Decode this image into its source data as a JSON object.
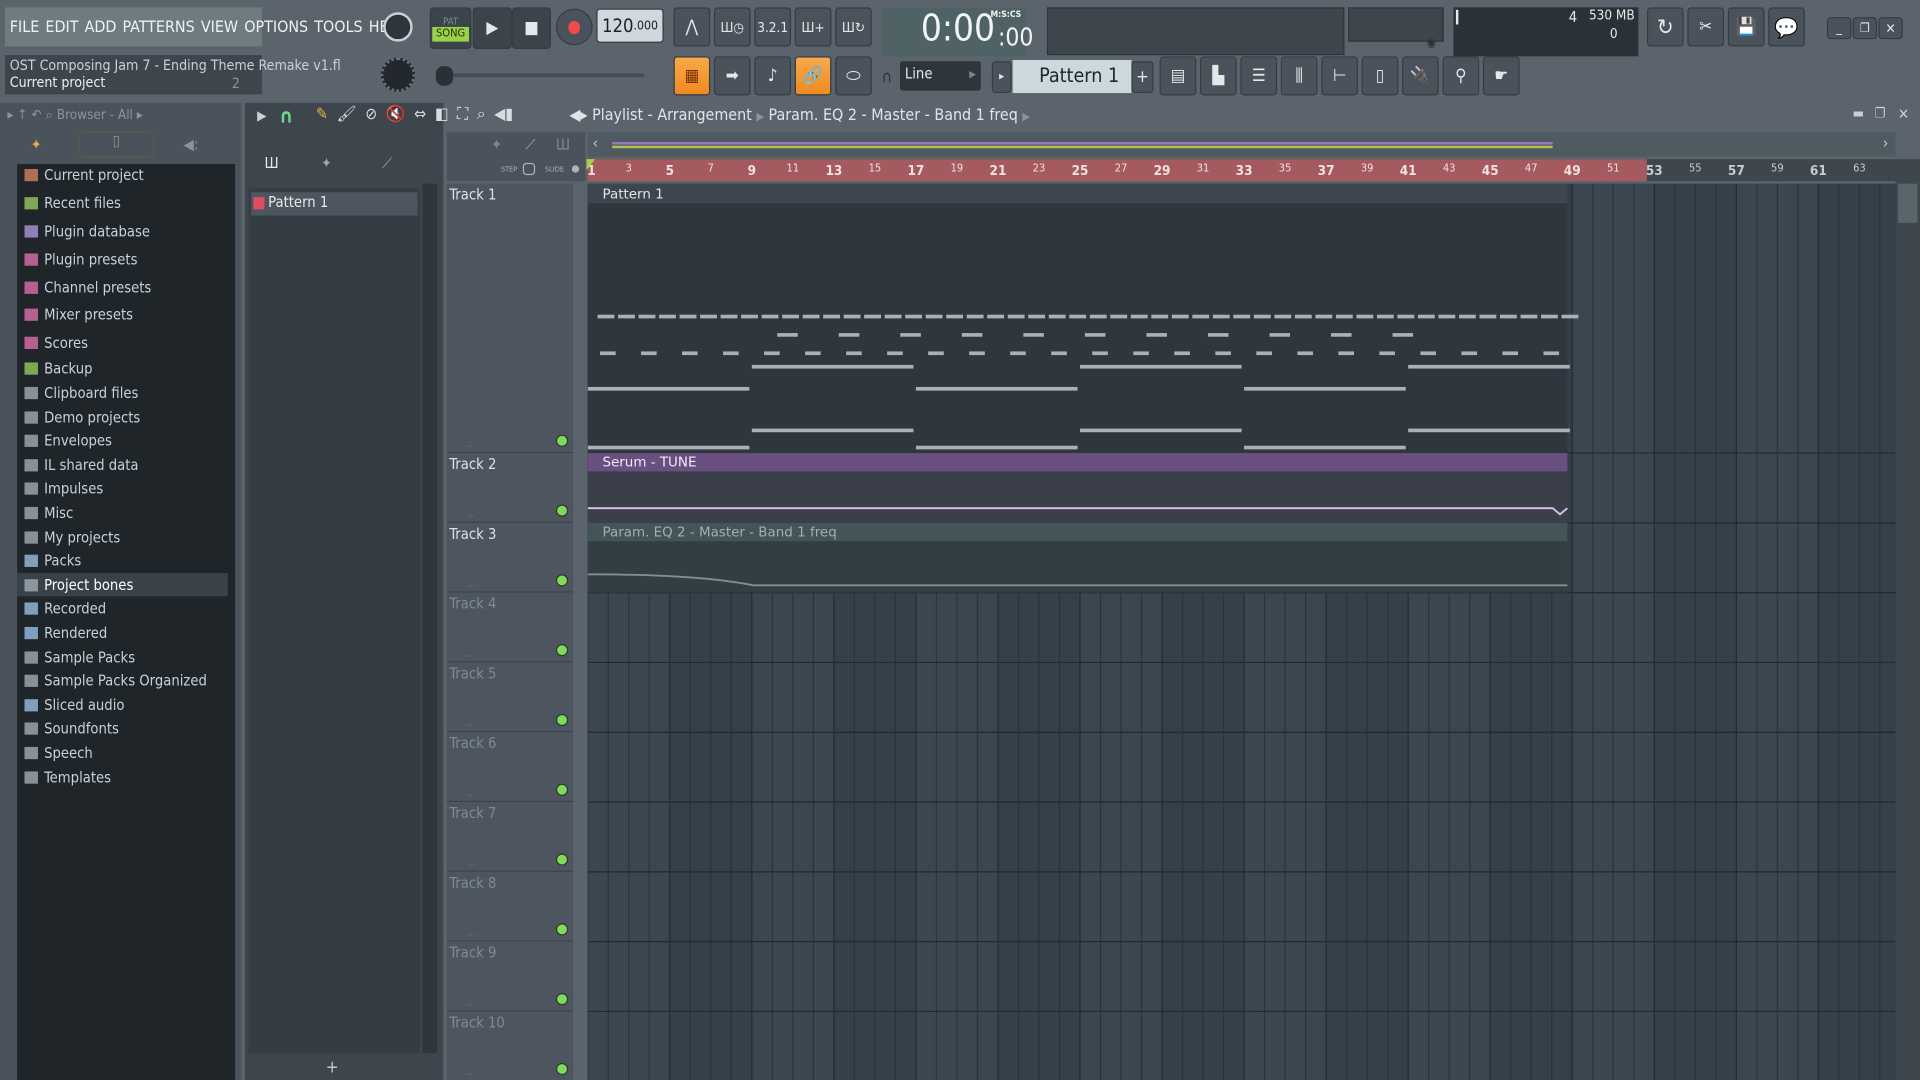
{
  "menu": [
    "FILE",
    "EDIT",
    "ADD",
    "PATTERNS",
    "VIEW",
    "OPTIONS",
    "TOOLS",
    "HELP"
  ],
  "transport": {
    "pat_label": "PAT",
    "song_label": "SONG",
    "tempo": "120",
    "tempo_dec": ".000",
    "time": "0:00",
    "time_cs": ":00",
    "time_format": "M:S:CS"
  },
  "project": {
    "title": "OST Composing Jam 7 - Ending Theme Remake v1.fl",
    "subtitle": "Current project",
    "num": "2"
  },
  "snap": {
    "value": "Line"
  },
  "pattern_selector": {
    "value": "Pattern 1",
    "add": "+"
  },
  "monitor": {
    "cpu": "4",
    "memory": "530 MB",
    "polyphony": "0"
  },
  "browser": {
    "title": "Browser - All",
    "items": [
      {
        "label": "Current project",
        "icon": "project-icon",
        "color": "#c97c5d"
      },
      {
        "label": "Recent files",
        "icon": "recent-folder-icon",
        "color": "#8fbf5a"
      },
      {
        "label": "Plugin database",
        "icon": "plugin-icon",
        "color": "#a48fd1"
      },
      {
        "label": "Plugin presets",
        "icon": "plugin-icon",
        "color": "#d16ba5"
      },
      {
        "label": "Channel presets",
        "icon": "channel-icon",
        "color": "#d16ba5"
      },
      {
        "label": "Mixer presets",
        "icon": "mixer-icon",
        "color": "#d16ba5"
      },
      {
        "label": "Scores",
        "icon": "note-icon",
        "color": "#d16ba5"
      },
      {
        "label": "Backup",
        "icon": "folder-icon",
        "color": "#8fbf5a"
      },
      {
        "label": "Clipboard files",
        "icon": "folder-icon",
        "color": "#9aa5ad"
      },
      {
        "label": "Demo projects",
        "icon": "folder-icon",
        "color": "#9aa5ad"
      },
      {
        "label": "Envelopes",
        "icon": "folder-icon",
        "color": "#9aa5ad"
      },
      {
        "label": "IL shared data",
        "icon": "folder-icon",
        "color": "#9aa5ad"
      },
      {
        "label": "Impulses",
        "icon": "folder-icon",
        "color": "#9aa5ad"
      },
      {
        "label": "Misc",
        "icon": "folder-icon",
        "color": "#9aa5ad"
      },
      {
        "label": "My projects",
        "icon": "folder-icon",
        "color": "#9aa5ad"
      },
      {
        "label": "Packs",
        "icon": "packs-icon",
        "color": "#8fb6d8"
      },
      {
        "label": "Project bones",
        "icon": "folder-icon",
        "color": "#9aa5ad"
      },
      {
        "label": "Recorded",
        "icon": "waveform-icon",
        "color": "#8fb6d8"
      },
      {
        "label": "Rendered",
        "icon": "waveform-icon",
        "color": "#8fb6d8"
      },
      {
        "label": "Sample Packs",
        "icon": "folder-icon",
        "color": "#9aa5ad"
      },
      {
        "label": "Sample Packs Organized",
        "icon": "folder-icon",
        "color": "#9aa5ad"
      },
      {
        "label": "Sliced audio",
        "icon": "waveform-icon",
        "color": "#8fb6d8"
      },
      {
        "label": "Soundfonts",
        "icon": "folder-icon",
        "color": "#9aa5ad"
      },
      {
        "label": "Speech",
        "icon": "folder-icon",
        "color": "#9aa5ad"
      },
      {
        "label": "Templates",
        "icon": "folder-icon",
        "color": "#9aa5ad"
      }
    ],
    "selected": "Project bones"
  },
  "picker": {
    "patterns": [
      "Pattern 1"
    ],
    "add": "+"
  },
  "playlist": {
    "title": "Playlist - Arrangement",
    "breadcrumb": "Param. EQ 2 - Master - Band 1 freq",
    "step_label": "STEP",
    "slide_label": "SLIDE",
    "bars": [
      1,
      3,
      5,
      7,
      9,
      11,
      13,
      15,
      17,
      19,
      21,
      23,
      25,
      27,
      29,
      31,
      33,
      35,
      37,
      39,
      41,
      43,
      45,
      47,
      49,
      51,
      53,
      55,
      57,
      59,
      61,
      63
    ],
    "tracks": [
      "Track 1",
      "Track 2",
      "Track 3",
      "Track 4",
      "Track 5",
      "Track 6",
      "Track 7",
      "Track 8",
      "Track 9",
      "Track 10"
    ],
    "clips": [
      {
        "track": 1,
        "label": "Pattern 1",
        "type": "pattern",
        "color": "#3d464f"
      },
      {
        "track": 2,
        "label": "Serum - TUNE",
        "type": "automation",
        "color": "#6a4f80"
      },
      {
        "track": 3,
        "label": "Param. EQ 2 - Master - Band 1 freq",
        "type": "automation",
        "color": "#44555a"
      }
    ]
  },
  "colors": {
    "accent": "#f39a2c",
    "ruler": "#a85a5e",
    "song_mode": "#9bd14a"
  }
}
